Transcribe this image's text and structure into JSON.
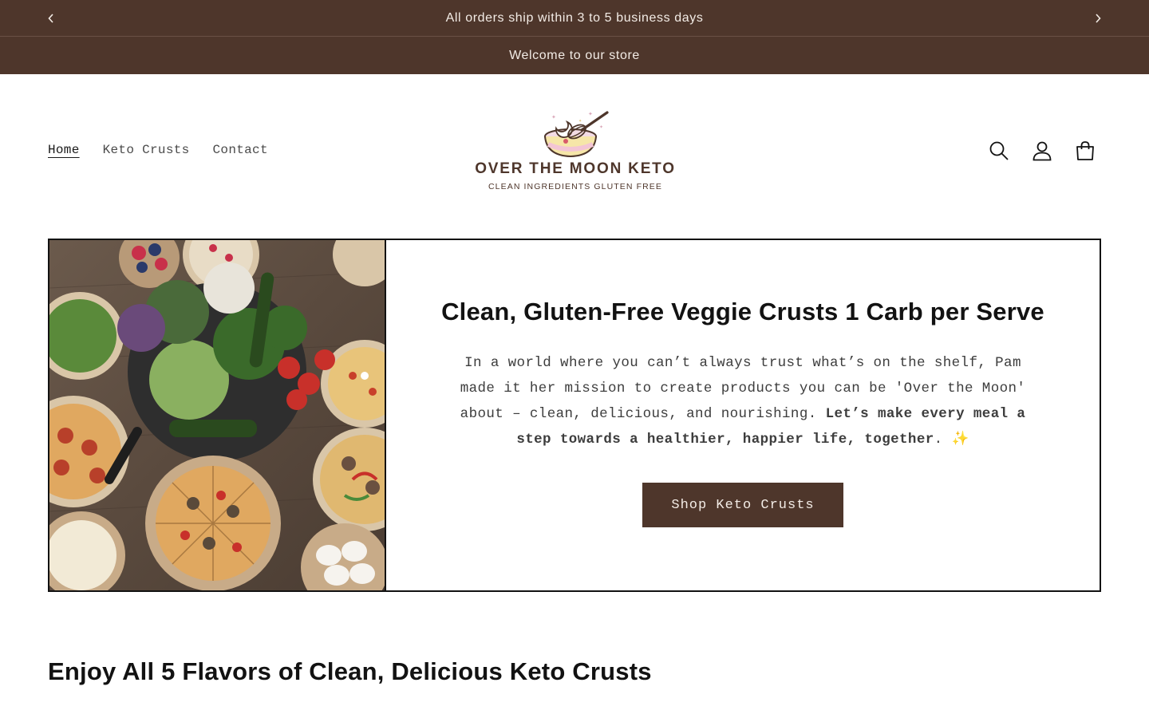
{
  "announcement": {
    "primary": "All orders ship within 3 to 5 business days",
    "secondary": "Welcome to our store"
  },
  "nav": {
    "items": [
      {
        "label": "Home",
        "active": true
      },
      {
        "label": "Keto Crusts",
        "active": false
      },
      {
        "label": "Contact",
        "active": false
      }
    ]
  },
  "logo": {
    "title": "OVER THE MOON KETO",
    "subtitle": "CLEAN INGREDIENTS GLUTEN FREE"
  },
  "header_icons": [
    "search-icon",
    "account-icon",
    "cart-icon"
  ],
  "hero": {
    "title": "Clean, Gluten-Free Veggie Crusts 1 Carb per Serve",
    "text_plain": "In a world where you can’t always trust what’s on the shelf, Pam made it her mission to create products you can be 'Over the Moon' about – clean, delicious, and nourishing.",
    "text_bold": "Let’s make every meal a step towards a healthier, happier life, together",
    "text_end": ".",
    "emoji": "✨",
    "button_label": "Shop Keto Crusts"
  },
  "section": {
    "title": "Enjoy All 5 Flavors of Clean, Delicious Keto Crusts"
  },
  "colors": {
    "brand": "#4e362b",
    "announcement_text": "#f3ece6",
    "border": "#121212"
  }
}
